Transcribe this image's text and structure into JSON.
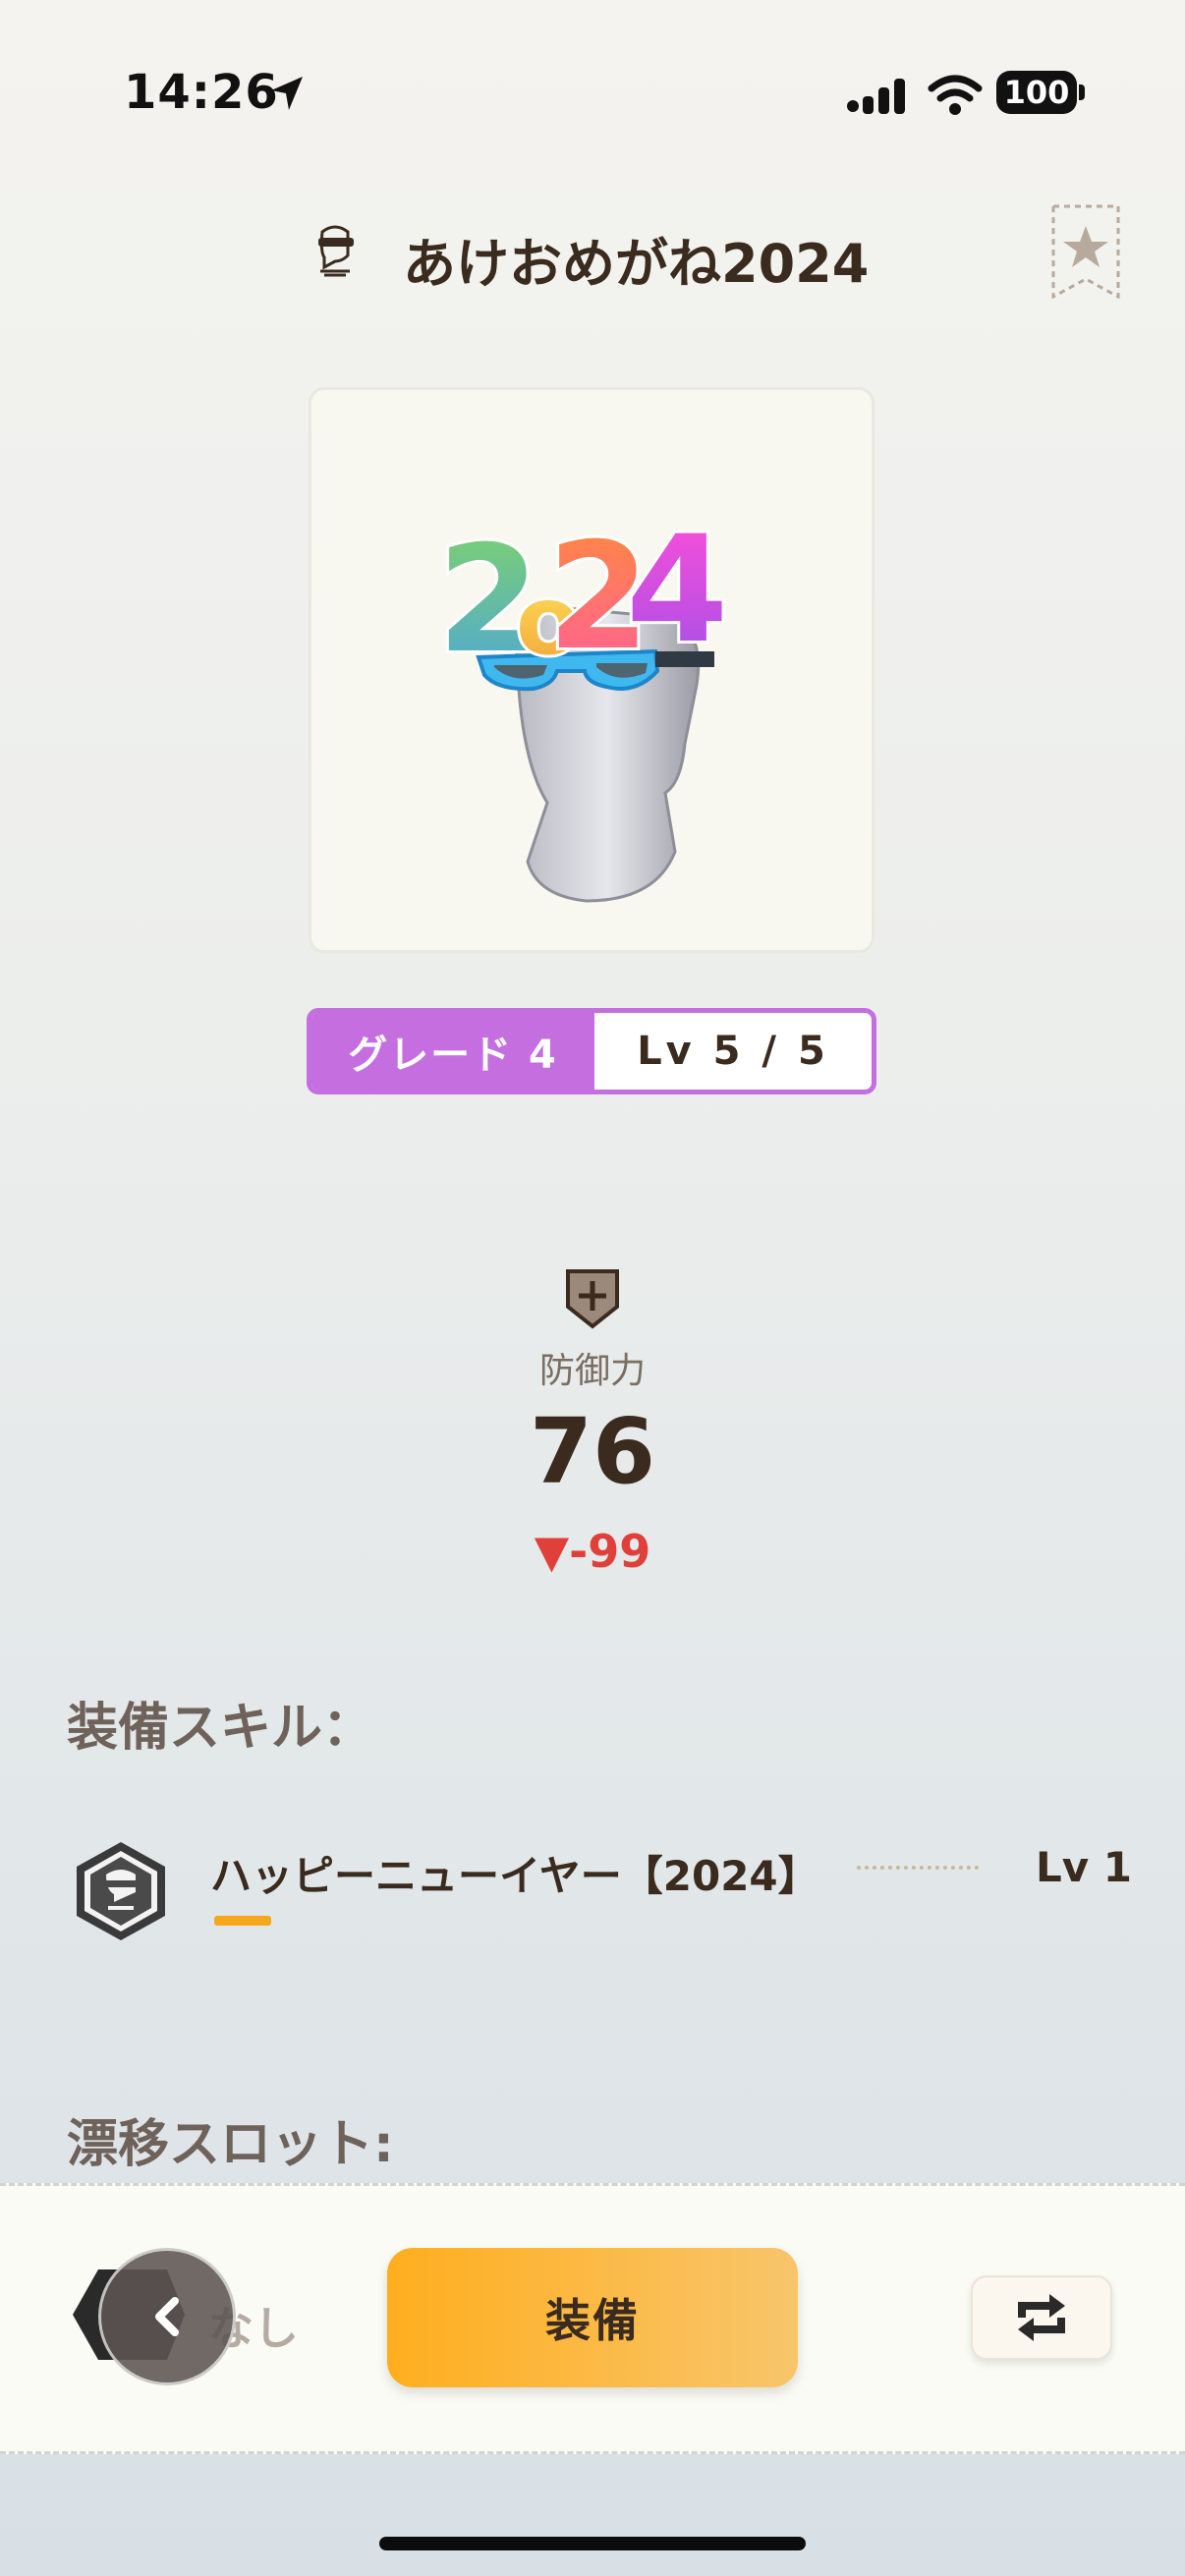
{
  "status_bar": {
    "time": "14:26",
    "battery": "100",
    "icons": [
      "location-arrow-icon",
      "cellular-signal-icon",
      "wifi-icon",
      "battery-icon"
    ]
  },
  "header": {
    "title": "あけおめがね2024",
    "type_icon": "glasses-head-icon",
    "favorite_icon": "star-bookmark-icon"
  },
  "item": {
    "image": "2024-party-glasses-on-mannequin-head",
    "grade_label": "グレード 4",
    "level_label": "Lv 5 / 5",
    "grade_color": "#c46ee0"
  },
  "stat": {
    "icon": "defense-shield-icon",
    "label": "防御力",
    "value": "76",
    "diff": "▼-99",
    "diff_color": "#e0403a"
  },
  "skills": {
    "section_label": "装備スキル：",
    "items": [
      {
        "name": "ハッピーニューイヤー【2024】",
        "level": "Lv 1",
        "icon": "skill-hexagon-badge-icon"
      }
    ]
  },
  "slots": {
    "section_label": "漂移スロット:",
    "empty_label": "なし"
  },
  "actions": {
    "equip_label": "装備",
    "back_icon": "chevron-left-icon",
    "swap_icon": "swap-arrows-icon"
  }
}
